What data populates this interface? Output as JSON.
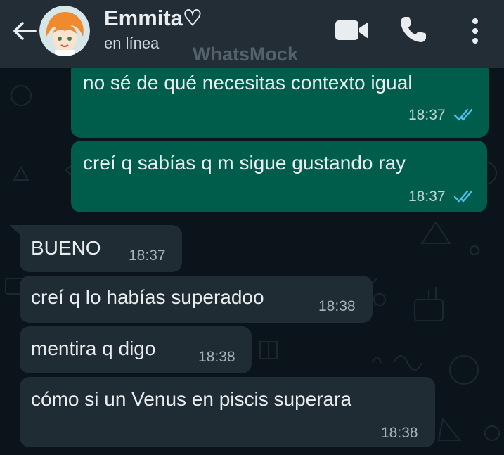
{
  "header": {
    "contact_name": "Emmita♡",
    "status": "en línea",
    "watermark": "WhatsMock",
    "icons": [
      "back-arrow-icon",
      "avatar",
      "video-call-icon",
      "voice-call-icon",
      "more-options-icon"
    ]
  },
  "messages": [
    {
      "direction": "out",
      "text": "no sé de qué necesitas contexto igual",
      "time": "18:37",
      "status": "read"
    },
    {
      "direction": "out",
      "text": "creí q sabías q m sigue gustando ray",
      "time": "18:37",
      "status": "read"
    },
    {
      "direction": "in",
      "text": "BUENO",
      "time": "18:37"
    },
    {
      "direction": "in",
      "text": "creí q lo habías superadoo",
      "time": "18:38"
    },
    {
      "direction": "in",
      "text": "mentira q digo",
      "time": "18:38"
    },
    {
      "direction": "in",
      "text": "cómo si un Venus en piscis superara",
      "time": "18:38"
    }
  ],
  "colors": {
    "header_bg": "#232d36",
    "outgoing_bubble": "#005c4b",
    "incoming_bubble": "#1f2c33",
    "read_ticks": "#53bdeb",
    "chat_bg": "#0b141a"
  }
}
